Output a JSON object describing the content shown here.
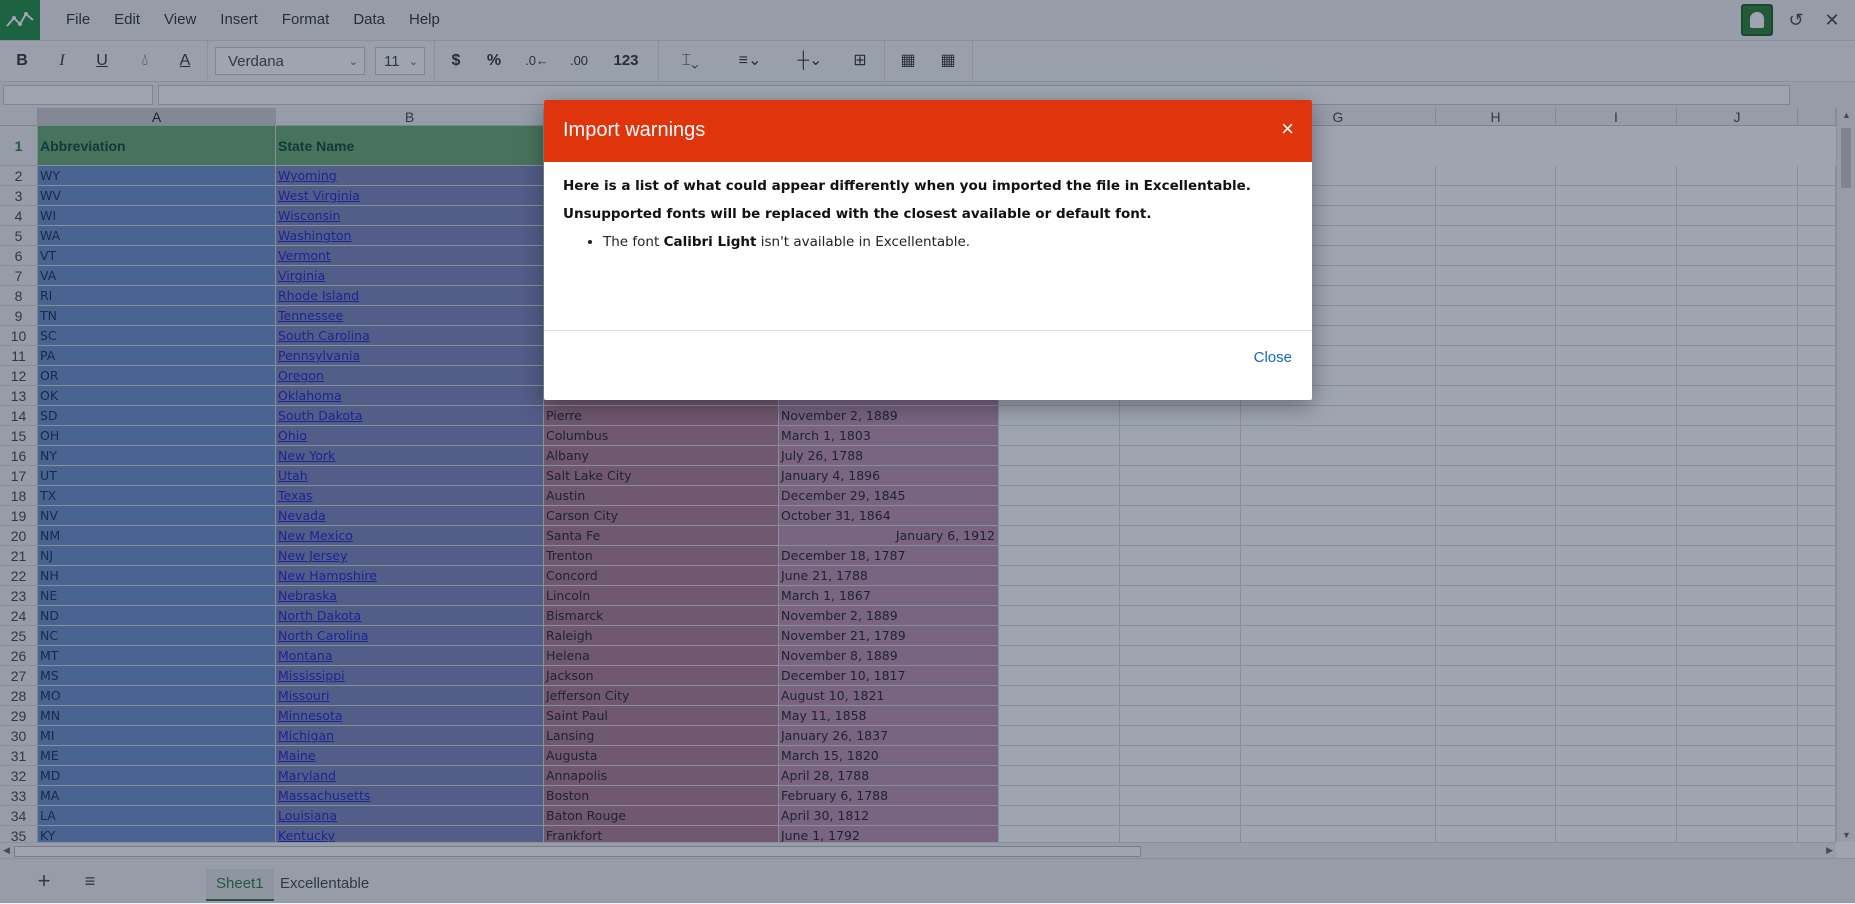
{
  "menu": {
    "items": [
      "File",
      "Edit",
      "View",
      "Insert",
      "Format",
      "Data",
      "Help"
    ]
  },
  "toolbar": {
    "bold": "B",
    "italic": "I",
    "underline": "U",
    "currency": "$",
    "percent": "%",
    "number_format": "123",
    "font_name": "Verdana",
    "font_size": "11"
  },
  "columns": [
    "A",
    "B",
    "",
    "",
    "",
    "",
    "G",
    "H",
    "I",
    "J"
  ],
  "selected_column": "A",
  "header": {
    "row_num": "1",
    "abbreviation": "Abbreviation",
    "state_name": "State Name"
  },
  "rows": [
    {
      "n": "2",
      "abbr": "WY",
      "state": "Wyoming",
      "capital": "",
      "date": ""
    },
    {
      "n": "3",
      "abbr": "WV",
      "state": "West Virginia",
      "capital": "",
      "date": ""
    },
    {
      "n": "4",
      "abbr": "WI",
      "state": "Wisconsin",
      "capital": "",
      "date": ""
    },
    {
      "n": "5",
      "abbr": "WA",
      "state": "Washington",
      "capital": "",
      "date": ""
    },
    {
      "n": "6",
      "abbr": "VT",
      "state": "Vermont",
      "capital": "",
      "date": ""
    },
    {
      "n": "7",
      "abbr": "VA",
      "state": "Virginia",
      "capital": "",
      "date": ""
    },
    {
      "n": "8",
      "abbr": "RI",
      "state": "Rhode Island",
      "capital": "",
      "date": ""
    },
    {
      "n": "9",
      "abbr": "TN",
      "state": "Tennessee",
      "capital": "",
      "date": ""
    },
    {
      "n": "10",
      "abbr": "SC",
      "state": "South Carolina",
      "capital": "",
      "date": ""
    },
    {
      "n": "11",
      "abbr": "PA",
      "state": "Pennsylvania",
      "capital": "",
      "date": ""
    },
    {
      "n": "12",
      "abbr": "OR",
      "state": "Oregon",
      "capital": "",
      "date": ""
    },
    {
      "n": "13",
      "abbr": "OK",
      "state": "Oklahoma",
      "capital": "",
      "date": ""
    },
    {
      "n": "14",
      "abbr": "SD",
      "state": "South Dakota",
      "capital": "Pierre",
      "date": "November 2, 1889"
    },
    {
      "n": "15",
      "abbr": "OH",
      "state": "Ohio",
      "capital": "Columbus",
      "date": "March 1, 1803"
    },
    {
      "n": "16",
      "abbr": "NY",
      "state": "New York",
      "capital": "Albany",
      "date": "July 26, 1788"
    },
    {
      "n": "17",
      "abbr": "UT",
      "state": "Utah",
      "capital": "Salt Lake City",
      "date": "January 4, 1896"
    },
    {
      "n": "18",
      "abbr": "TX",
      "state": "Texas",
      "capital": "Austin",
      "date": "December 29, 1845"
    },
    {
      "n": "19",
      "abbr": "NV",
      "state": "Nevada",
      "capital": "Carson City",
      "date": "October 31, 1864"
    },
    {
      "n": "20",
      "abbr": "NM",
      "state": "New Mexico",
      "capital": "Santa Fe",
      "date": "January 6, 1912",
      "align": "right"
    },
    {
      "n": "21",
      "abbr": "NJ",
      "state": "New Jersey",
      "capital": "Trenton",
      "date": "December 18, 1787"
    },
    {
      "n": "22",
      "abbr": "NH",
      "state": "New Hampshire",
      "capital": "Concord",
      "date": "June 21, 1788"
    },
    {
      "n": "23",
      "abbr": "NE",
      "state": "Nebraska",
      "capital": "Lincoln",
      "date": "March 1, 1867"
    },
    {
      "n": "24",
      "abbr": "ND",
      "state": "North Dakota",
      "capital": "Bismarck",
      "date": "November 2, 1889"
    },
    {
      "n": "25",
      "abbr": "NC",
      "state": "North Carolina",
      "capital": "Raleigh",
      "date": "November 21, 1789"
    },
    {
      "n": "26",
      "abbr": "MT",
      "state": "Montana",
      "capital": "Helena",
      "date": "November 8, 1889"
    },
    {
      "n": "27",
      "abbr": "MS",
      "state": "Mississippi",
      "capital": "Jackson",
      "date": "December 10, 1817"
    },
    {
      "n": "28",
      "abbr": "MO",
      "state": "Missouri",
      "capital": "Jefferson City",
      "date": "August 10, 1821"
    },
    {
      "n": "29",
      "abbr": "MN",
      "state": "Minnesota",
      "capital": "Saint Paul",
      "date": "May 11, 1858"
    },
    {
      "n": "30",
      "abbr": "MI",
      "state": "Michigan",
      "capital": "Lansing",
      "date": "January 26, 1837"
    },
    {
      "n": "31",
      "abbr": "ME",
      "state": "Maine",
      "capital": "Augusta",
      "date": "March 15, 1820"
    },
    {
      "n": "32",
      "abbr": "MD",
      "state": "Maryland",
      "capital": "Annapolis",
      "date": "April 28, 1788"
    },
    {
      "n": "33",
      "abbr": "MA",
      "state": "Massachusetts",
      "capital": "Boston",
      "date": "February 6, 1788"
    },
    {
      "n": "34",
      "abbr": "LA",
      "state": "Louisiana",
      "capital": "Baton Rouge",
      "date": "April 30, 1812"
    },
    {
      "n": "35",
      "abbr": "KY",
      "state": "Kentucky",
      "capital": "Frankfort",
      "date": "June 1, 1792"
    }
  ],
  "sheets": {
    "tabs": [
      "Sheet1",
      "Excellentable"
    ],
    "active": "Sheet1"
  },
  "dialog": {
    "title": "Import warnings",
    "intro": "Here is a list of what could appear differently when you imported the file in Excellentable.",
    "fonts_heading": "Unsupported fonts will be replaced with the closest available or default font.",
    "font_item_prefix": "The font ",
    "font_item_name": "Calibri Light",
    "font_item_suffix": " isn't available in Excellentable.",
    "close_label": "Close",
    "close_icon": "×"
  },
  "colors": {
    "dialog_header": "#e0340c",
    "link": "#1565c0",
    "accent": "#2e7d32"
  }
}
